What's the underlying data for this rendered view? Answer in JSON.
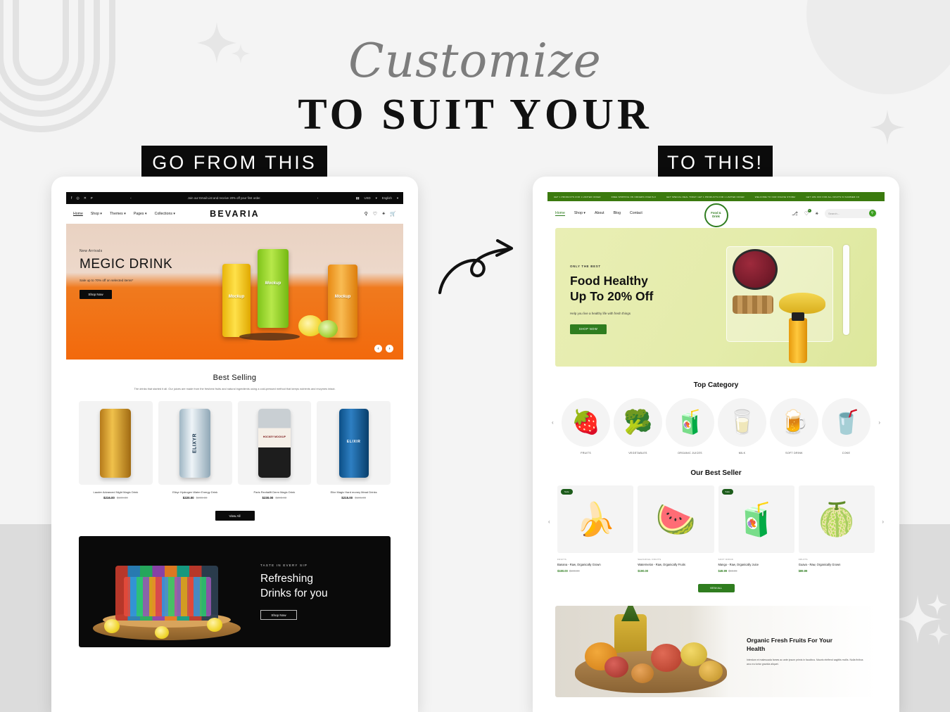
{
  "poster": {
    "script_heading": "Customize",
    "main_heading": "TO SUIT YOUR",
    "label_left": "GO FROM THIS",
    "label_right": "TO THIS!"
  },
  "left_site": {
    "announcement": {
      "message": "Join our Email List and receive 20% off your first order.",
      "prev": "‹",
      "next": "›",
      "currency": "USD",
      "language": "English",
      "social": [
        "f",
        "◎",
        "✕",
        "ᴘ"
      ]
    },
    "nav": {
      "links": [
        "Home",
        "Shop",
        "Themes",
        "Pages",
        "Collections"
      ],
      "active": "Home",
      "logo": "BEVARIA",
      "icons": [
        "search-icon",
        "wishlist-icon",
        "account-icon",
        "cart-icon"
      ],
      "wishlist_count": "0"
    },
    "hero": {
      "kicker": "New Arrivals",
      "title": "MEGIC DRINK",
      "subtitle": "Sale up to 70% off on selected items*",
      "button": "Shop Now",
      "can_labels": [
        "Mockup",
        "Mockup",
        "Mockup"
      ],
      "slide_prev": "‹",
      "slide_next": "›"
    },
    "best_selling": {
      "title": "Best Selling",
      "description": "The drinks that started it all. Our juices are made from the freshest fruits and natural ingredients using a cold-pressed method that keeps nutrients and enzymes intact.",
      "products": [
        {
          "name": "Lauder Advanced Night Magic Drink",
          "price": "$216.00",
          "compare": "$199.00",
          "can_text": ""
        },
        {
          "name": "Elixyr Hydrogen Water Energy Drink",
          "price": "$220.00",
          "compare": "$200.00",
          "can_text": "ELIXYR"
        },
        {
          "name": "Paris Revitalift Derm Magic Drink",
          "price": "$230.00",
          "compare": "$200.00",
          "can_text": "HOCKEY MOCKUP"
        },
        {
          "name": "Elixr Magic Hard money Mead Drinks",
          "price": "$215.00",
          "compare": "$195.00",
          "can_text": "ELIXIR"
        }
      ],
      "view_all": "View All"
    },
    "banner": {
      "kicker": "TASTE IN EVERY SIP",
      "heading_line1": "Refreshing",
      "heading_line2": "Drinks for you",
      "button": "Shop Now"
    }
  },
  "right_site": {
    "announcement": [
      "GET 1 PRODUCTS FOR 1 LIMITED OFFER",
      "FREE SHIPPING ON ORDERS OVER $-0",
      "GET SPECIAL DEAL TODAY GET 1 PRODUCTS FOR 1 LIMITED OFFER",
      "WELCOME TO OUR ONLINE STORE!",
      "GET 10% OFF FOR ALL FRUITS IN SUMMER CO"
    ],
    "nav": {
      "links": [
        "Home",
        "Shop",
        "About",
        "Blog",
        "Contact"
      ],
      "active": "Home",
      "logo_line1": "Food &",
      "logo_line2": "Drink",
      "icons": [
        "bag-icon",
        "wishlist-icon",
        "account-icon"
      ],
      "wishlist_count": "0",
      "search_placeholder": "Search...",
      "search_icon": "search-icon"
    },
    "hero": {
      "kicker": "ONLY THE BEST",
      "title_line1": "Food Healthy",
      "title_line2": "Up To 20% Off",
      "subtitle": "Help you live a healthy life with fresh things",
      "button": "SHOP NOW"
    },
    "top_category": {
      "title": "Top Category",
      "prev": "‹",
      "next": "›",
      "items": [
        {
          "name": "FRUITS",
          "glyph": "🍓"
        },
        {
          "name": "VEGETABLES",
          "glyph": "🥦"
        },
        {
          "name": "ORGANIC JUICES",
          "glyph": "🧃"
        },
        {
          "name": "MILK",
          "glyph": "🥛"
        },
        {
          "name": "SOFT DRINK",
          "glyph": "🍺"
        },
        {
          "name": "COKE",
          "glyph": "🥤"
        }
      ]
    },
    "best_seller": {
      "title": "Our Best Seller",
      "prev": "‹",
      "next": "›",
      "view_all": "VIEW ALL",
      "badge": "Sale",
      "products": [
        {
          "category": "FRUITS",
          "name": "Banana - Raw, Organically Grown",
          "price": "$180.00",
          "compare": "$199.00",
          "badge": "Sale",
          "glyph": "🍌"
        },
        {
          "category": "SEASONAL FRUITS",
          "name": "Watermelon - Raw, Organically Fruits",
          "price": "$190.00",
          "compare": "",
          "badge": "",
          "glyph": "🍉"
        },
        {
          "category": "SOFT DRINK",
          "name": "Mango - Raw, Organically Juice",
          "price": "$49.99",
          "compare": "$59.99",
          "badge": "Sale",
          "glyph": "🧃"
        },
        {
          "category": "FRUITS",
          "name": "Guava - Raw, Organically Grown",
          "price": "$89.99",
          "compare": "",
          "badge": "",
          "glyph": "🍈"
        }
      ]
    },
    "bottom": {
      "heading_line1": "Organic Fresh Fruits For Your",
      "heading_line2": "Health",
      "paragraph": "Interdum et malesuada fames ac ante ipsum primis in faucibus. Mauris eleifend sagittis mollis. Nulla finibus arcu eu tortor gravida aliquet.",
      "basket_glyph": "🍍"
    }
  },
  "colors": {
    "green": "#2f7d1f",
    "green_bar": "#3b7a0e",
    "orange": "#f2690c",
    "black": "#0b0b0b",
    "page_bg": "#f4f4f4",
    "bottom_bg": "#dcdcdc"
  }
}
